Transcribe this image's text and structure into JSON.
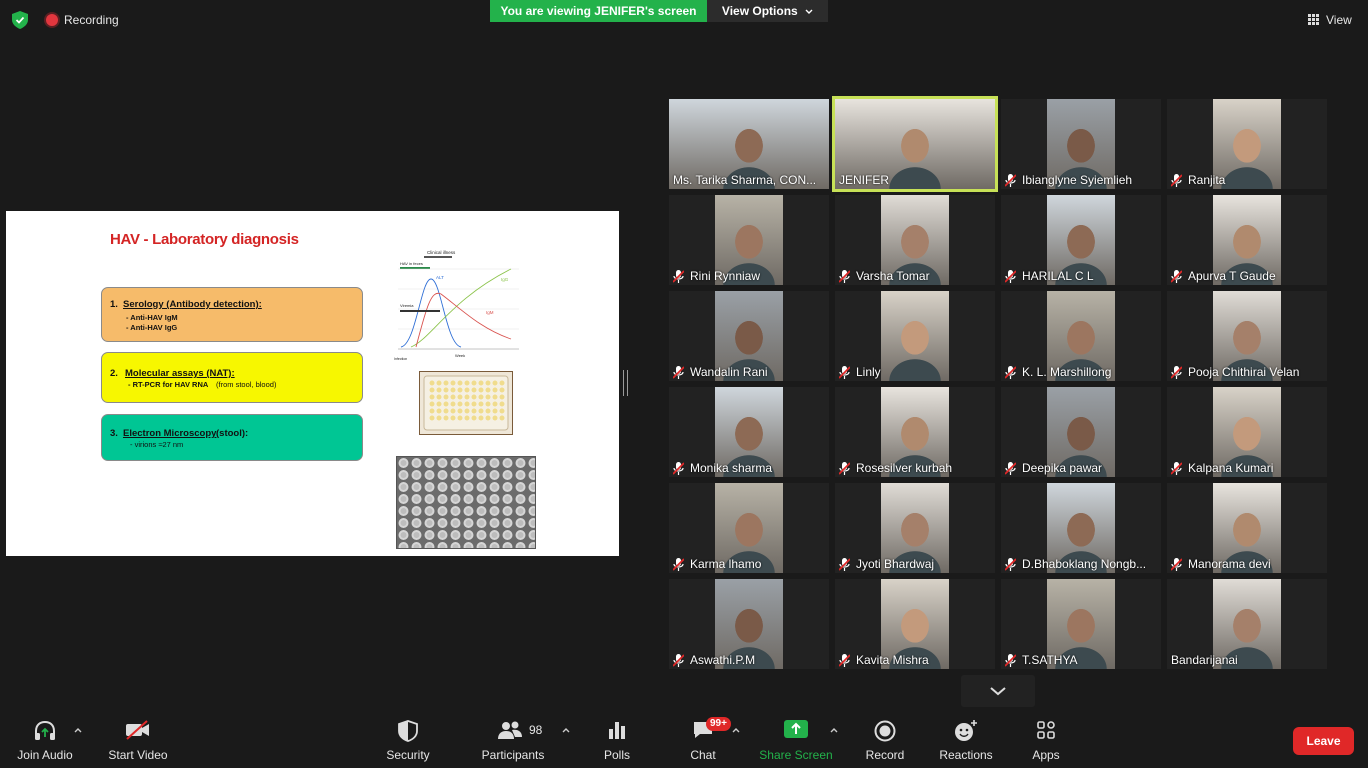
{
  "topbar": {
    "recording_label": "Recording",
    "viewing_banner": "You are viewing JENIFER's screen",
    "view_options": "View Options",
    "view_label": "View"
  },
  "slide": {
    "title": "HAV - Laboratory diagnosis",
    "boxes": [
      {
        "num": "1.",
        "head": "Serology (Antibody detection):",
        "lines": [
          "- Anti-HAV  IgM",
          "- Anti-HAV  IgG"
        ]
      },
      {
        "num": "2.",
        "head": "Molecular assays (NAT):",
        "lines": [
          "- RT-PCR  for HAV RNA",
          "(from stool, blood)"
        ]
      },
      {
        "num": "3.",
        "head": "Electron Microscopy",
        "head_extra": "(stool):",
        "lines": [
          "-  virions ≈27 nm"
        ]
      }
    ],
    "graph_labels": {
      "top": "Clinical illness",
      "hav_feces": "HAV in feces",
      "alt": "ALT",
      "igg": "IgG",
      "viremia": "Viremia",
      "igm": "IgM",
      "week": "Week",
      "infection": "Infection"
    }
  },
  "participants": [
    {
      "name": "Ms. Tarika Sharma, CON...",
      "muted": false,
      "active": false
    },
    {
      "name": "JENIFER",
      "muted": false,
      "active": true
    },
    {
      "name": "Ibianglyne Syiemlieh",
      "muted": true,
      "active": false
    },
    {
      "name": "Ranjita",
      "muted": true,
      "active": false
    },
    {
      "name": "Rini Rynniaw",
      "muted": true,
      "active": false
    },
    {
      "name": "Varsha Tomar",
      "muted": true,
      "active": false
    },
    {
      "name": "HARILAL C L",
      "muted": true,
      "active": false
    },
    {
      "name": "Apurva T Gaude",
      "muted": true,
      "active": false
    },
    {
      "name": "Wandalin Rani",
      "muted": true,
      "active": false
    },
    {
      "name": "Linly",
      "muted": true,
      "active": false
    },
    {
      "name": "K. L. Marshillong",
      "muted": true,
      "active": false
    },
    {
      "name": "Pooja Chithirai Velan",
      "muted": true,
      "active": false
    },
    {
      "name": "Monika sharma",
      "muted": true,
      "active": false
    },
    {
      "name": "Rosesilver kurbah",
      "muted": true,
      "active": false
    },
    {
      "name": "Deepika pawar",
      "muted": true,
      "active": false
    },
    {
      "name": "Kalpana Kumari",
      "muted": true,
      "active": false
    },
    {
      "name": "Karma lhamo",
      "muted": true,
      "active": false
    },
    {
      "name": "Jyoti Bhardwaj",
      "muted": true,
      "active": false
    },
    {
      "name": "D.Bhaboklang Nongb...",
      "muted": true,
      "active": false
    },
    {
      "name": "Manorama devi",
      "muted": true,
      "active": false
    },
    {
      "name": "Aswathi.P.M",
      "muted": true,
      "active": false
    },
    {
      "name": "Kavita Mishra",
      "muted": true,
      "active": false
    },
    {
      "name": "T.SATHYA",
      "muted": true,
      "active": false
    },
    {
      "name": "Bandarijanai",
      "muted": false,
      "active": false
    }
  ],
  "toolbar": {
    "join_audio": "Join Audio",
    "start_video": "Start Video",
    "security": "Security",
    "participants": "Participants",
    "participants_count": "98",
    "polls": "Polls",
    "chat": "Chat",
    "chat_badge": "99+",
    "share_screen": "Share Screen",
    "record": "Record",
    "reactions": "Reactions",
    "apps": "Apps",
    "leave": "Leave"
  },
  "colors": {
    "banner_green": "#23b24b",
    "leave_red": "#e02828",
    "active_speaker": "#c7e157",
    "share_green": "#23b24b"
  }
}
